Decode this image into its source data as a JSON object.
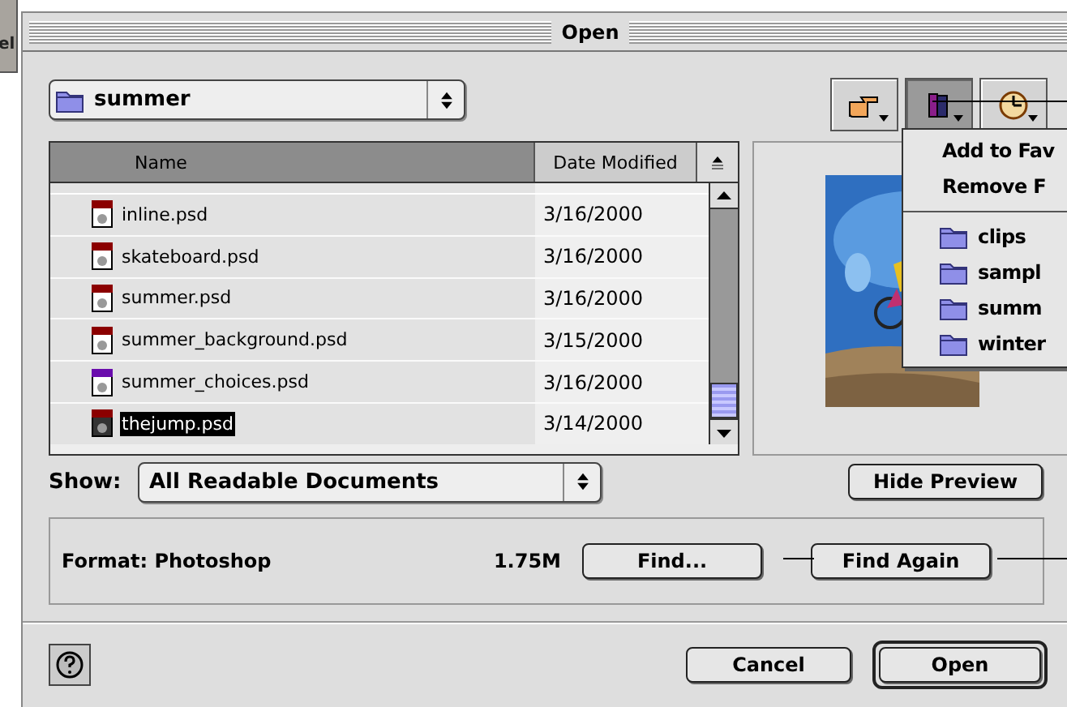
{
  "background_window": {
    "text": "el"
  },
  "window": {
    "title": "Open"
  },
  "folder_popup": {
    "value": "summer"
  },
  "toolbar": [
    {
      "kind": "shortcuts",
      "selected": false
    },
    {
      "kind": "favorites",
      "selected": true
    },
    {
      "kind": "recent",
      "selected": false
    }
  ],
  "file_list": {
    "columns": [
      {
        "label": "Name",
        "selected": true
      },
      {
        "label": "Date Modified",
        "selected": false
      }
    ],
    "rows": [
      {
        "name": "inline.psd",
        "date": "3/16/2000",
        "color": "#8b0000",
        "selected": false
      },
      {
        "name": "skateboard.psd",
        "date": "3/16/2000",
        "color": "#8b0000",
        "selected": false
      },
      {
        "name": "summer.psd",
        "date": "3/16/2000",
        "color": "#8b0000",
        "selected": false
      },
      {
        "name": "summer_background.psd",
        "date": "3/15/2000",
        "color": "#8b0000",
        "selected": false
      },
      {
        "name": "summer_choices.psd",
        "date": "3/16/2000",
        "color": "#6a0dad",
        "selected": false
      },
      {
        "name": "thejump.psd",
        "date": "3/14/2000",
        "color": "#8b0000",
        "selected": true
      }
    ]
  },
  "preview": {
    "kind": "picture"
  },
  "favorites_menu": {
    "items": [
      {
        "kind": "command",
        "label": "Add to Fav"
      },
      {
        "kind": "command",
        "label": "Remove F"
      },
      {
        "kind": "folder",
        "label": "clips"
      },
      {
        "kind": "folder",
        "label": "sampl"
      },
      {
        "kind": "folder",
        "label": "summ"
      },
      {
        "kind": "folder",
        "label": "winter"
      }
    ]
  },
  "show": {
    "label": "Show:",
    "value": "All Readable Documents"
  },
  "hide_preview_button": "Hide Preview",
  "format": {
    "label": "Format: Photoshop",
    "size": "1.75M"
  },
  "find_buttons": [
    "Find...",
    "Find Again"
  ],
  "buttons": [
    {
      "label": "Cancel",
      "default": false
    },
    {
      "label": "Open",
      "default": true
    }
  ]
}
